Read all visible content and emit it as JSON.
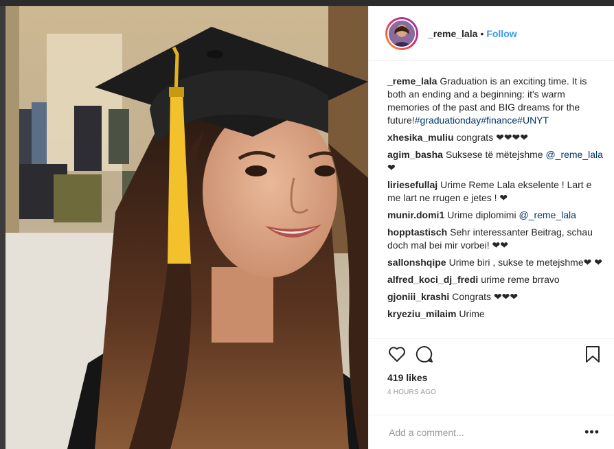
{
  "post": {
    "username": "_reme_lala",
    "follow_label": "Follow",
    "separator": "•"
  },
  "caption": {
    "username": "_reme_lala",
    "text": "Graduation is an exciting time. It is both an ending and a beginning: it's warm memories of the past and BIG dreams for the future!",
    "hashtags": [
      "#graduationday",
      "#finance",
      "#UNYT"
    ]
  },
  "comments": [
    {
      "user": "xhesika_muliu",
      "text": "congrats ❤❤❤❤"
    },
    {
      "user": "agim_basha",
      "text": "Suksese të mëtejshme",
      "mention": "@_reme_lala",
      "after": " ❤"
    },
    {
      "user": "liriesefullaj",
      "text": "Urime Reme Lala ekselente ! Lart e me lart ne rrugen e jetes ! ❤"
    },
    {
      "user": "munir.domi1",
      "text": "Urime diplomimi",
      "mention": "@_reme_lala",
      "after": ""
    },
    {
      "user": "hopptastisch",
      "text": "Sehr interessanter Beitrag, schau doch mal bei mir vorbei! ❤❤"
    },
    {
      "user": "sallonshqipe",
      "text": "Urime biri , sukse te metejshme❤ ❤"
    },
    {
      "user": "alfred_koci_dj_fredi",
      "text": "urime reme brravo"
    },
    {
      "user": "gjoniii_krashi",
      "text": "Congrats ❤❤❤"
    },
    {
      "user": "kryeziu_milaim",
      "text": "Urime"
    }
  ],
  "icons": {
    "like": "heart-outline-icon",
    "comment": "speech-bubble-icon",
    "save": "bookmark-icon",
    "more": "more-options-icon"
  },
  "likes": "419 likes",
  "timestamp": "4 HOURS AGO",
  "add_comment": {
    "placeholder": "Add a comment..."
  },
  "more_label": "•••",
  "colors": {
    "link": "#3897f0",
    "hashtag": "#003569",
    "text": "#262626",
    "muted": "#999999"
  }
}
